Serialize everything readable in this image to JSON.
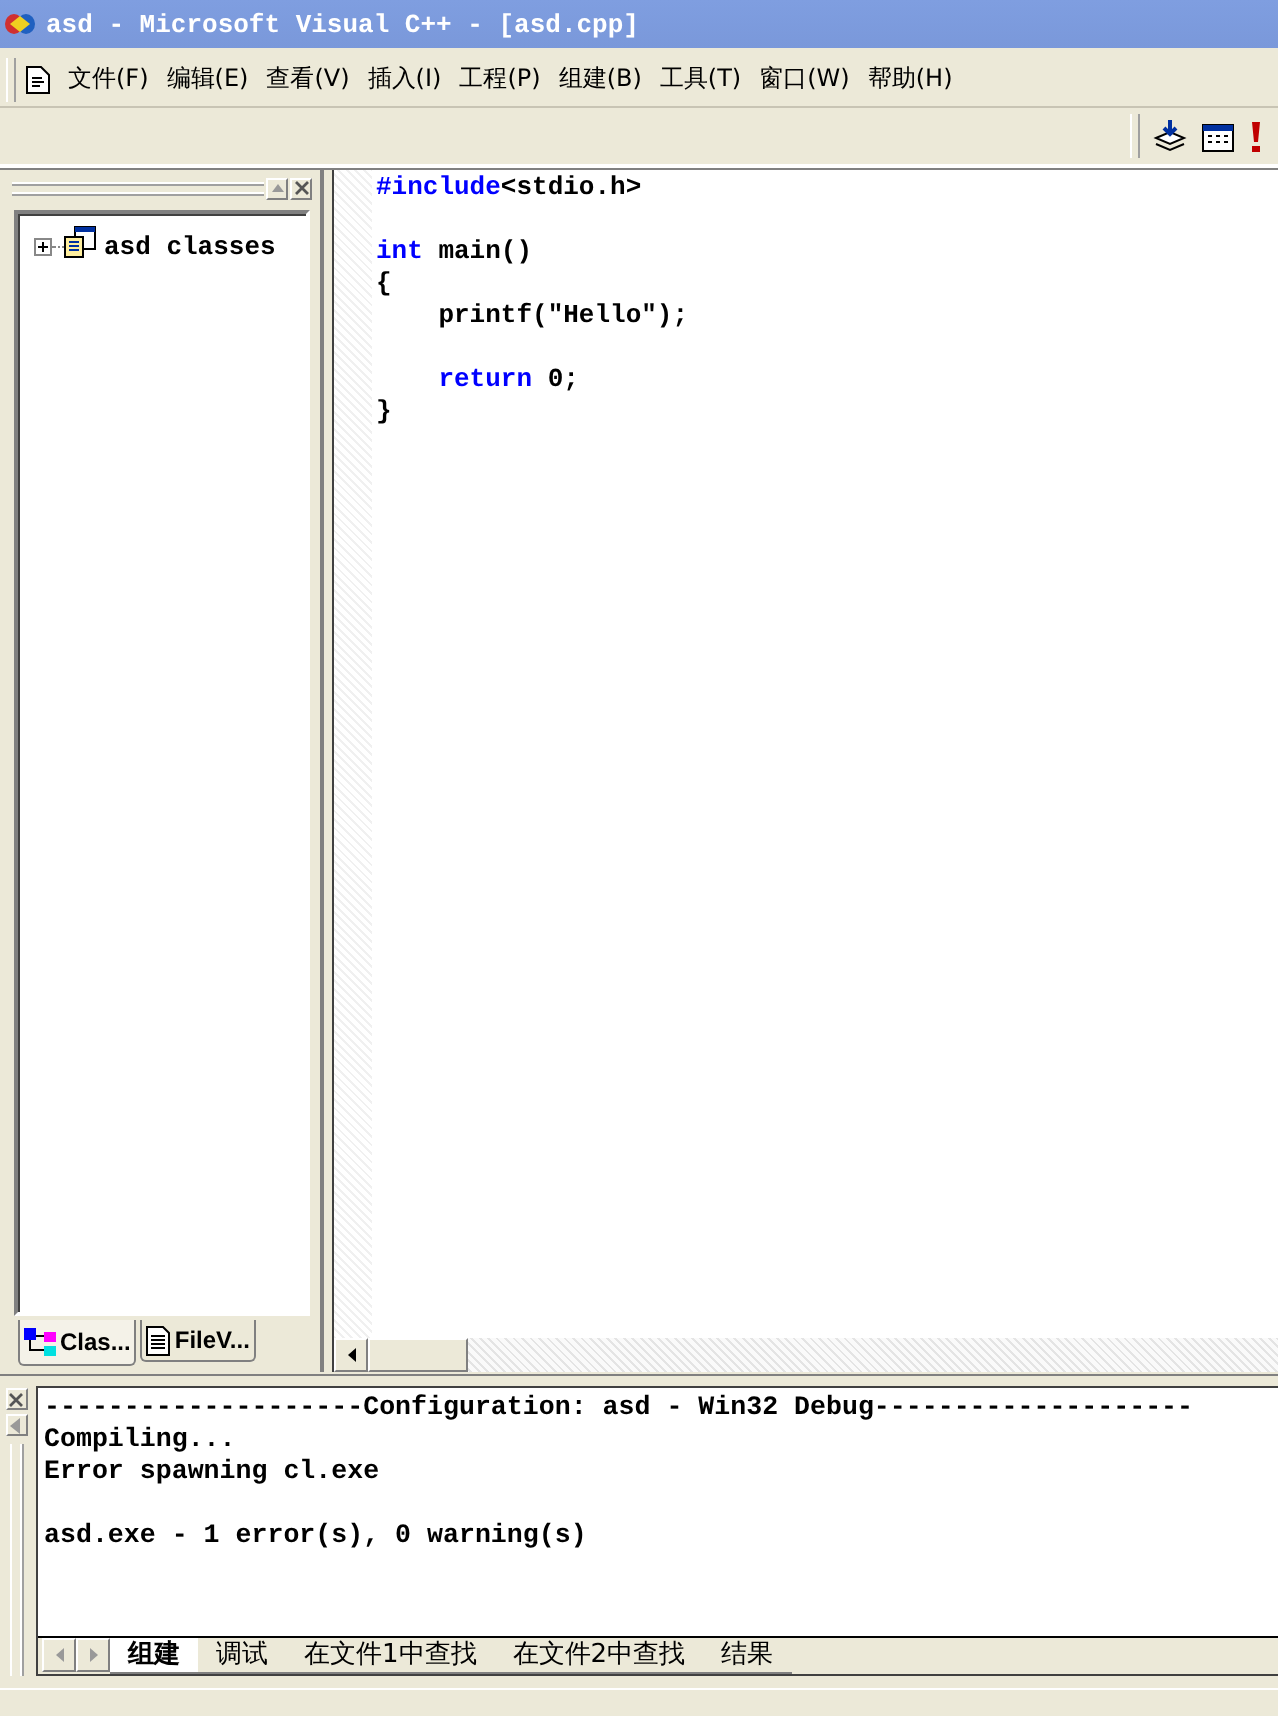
{
  "window": {
    "title": "asd - Microsoft Visual C++ - [asd.cpp]"
  },
  "menu": [
    "文件(F)",
    "编辑(E)",
    "查看(V)",
    "插入(I)",
    "工程(P)",
    "组建(B)",
    "工具(T)",
    "窗口(W)",
    "帮助(H)"
  ],
  "workspace": {
    "tree": [
      {
        "label": "asd classes",
        "expanded": false
      }
    ],
    "tabs": [
      {
        "label": "Clas...",
        "kind": "classes",
        "selected": true
      },
      {
        "label": "FileV...",
        "kind": "files",
        "selected": false
      }
    ]
  },
  "editor": {
    "lines": [
      {
        "tokens": [
          {
            "text": "#include",
            "kind": "keyword"
          },
          {
            "text": "<stdio.h>",
            "kind": "plain"
          }
        ]
      },
      {
        "gap_before": true,
        "tokens": [
          {
            "text": "int",
            "kind": "keyword"
          },
          {
            "text": " main()",
            "kind": "plain"
          }
        ]
      },
      {
        "tokens": [
          {
            "text": "{",
            "kind": "plain"
          }
        ]
      },
      {
        "tokens": [
          {
            "text": "    printf(\"Hello\");",
            "kind": "plain"
          }
        ]
      },
      {
        "gap_before": true,
        "tokens": [
          {
            "text": "    return",
            "kind": "keyword"
          },
          {
            "text": " 0;",
            "kind": "plain"
          }
        ]
      },
      {
        "tokens": [
          {
            "text": "}",
            "kind": "plain"
          }
        ]
      }
    ]
  },
  "output": {
    "lines": [
      {
        "text": "--------------------Configuration: asd - Win32 Debug--------------------"
      },
      {
        "text": "Compiling..."
      },
      {
        "text": "Error spawning cl.exe"
      },
      {
        "text": "asd.exe - 1 error(s), 0 warning(s)",
        "gap_before": true
      }
    ],
    "tabs": [
      {
        "label": "组建",
        "selected": true
      },
      {
        "label": "调试",
        "selected": false
      },
      {
        "label": "在文件1中查找",
        "selected": false
      },
      {
        "label": "在文件2中查找",
        "selected": false
      },
      {
        "label": "结果",
        "selected": false
      }
    ]
  }
}
